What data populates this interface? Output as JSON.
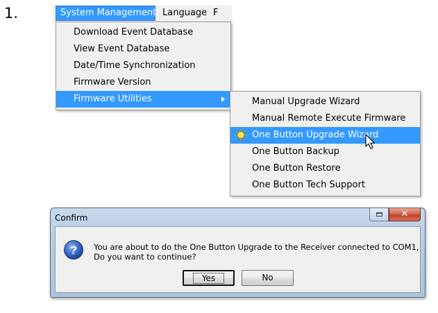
{
  "step_number": "1.",
  "menubar": {
    "active": "System Management",
    "language": "Language",
    "cut_off": "F"
  },
  "system_menu": {
    "items": [
      "Download Event Database",
      "View Event Database",
      "Date/Time Synchronization",
      "Firmware Version",
      "Firmware Utilities"
    ],
    "highlighted": "Firmware Utilities"
  },
  "firmware_submenu": {
    "items": [
      "Manual Upgrade Wizard",
      "Manual Remote Execute Firmware",
      "One Button Upgrade Wizard",
      "One Button Backup",
      "One Button Restore",
      "One Button Tech Support"
    ],
    "highlighted": "One Button Upgrade Wizard",
    "highlight_icon": "lightbulb-icon"
  },
  "dialog": {
    "title": "Confirm",
    "message_line1": "You are about to do the One Button Upgrade to the Receiver connected to COM1,",
    "message_line2": "Do you want to continue?",
    "icon": "question-icon",
    "yes_label": "Yes",
    "no_label": "No"
  },
  "colors": {
    "menu_highlight": "#3399ff",
    "menu_background": "#f0f0f0",
    "close_button": "#c2432a"
  }
}
